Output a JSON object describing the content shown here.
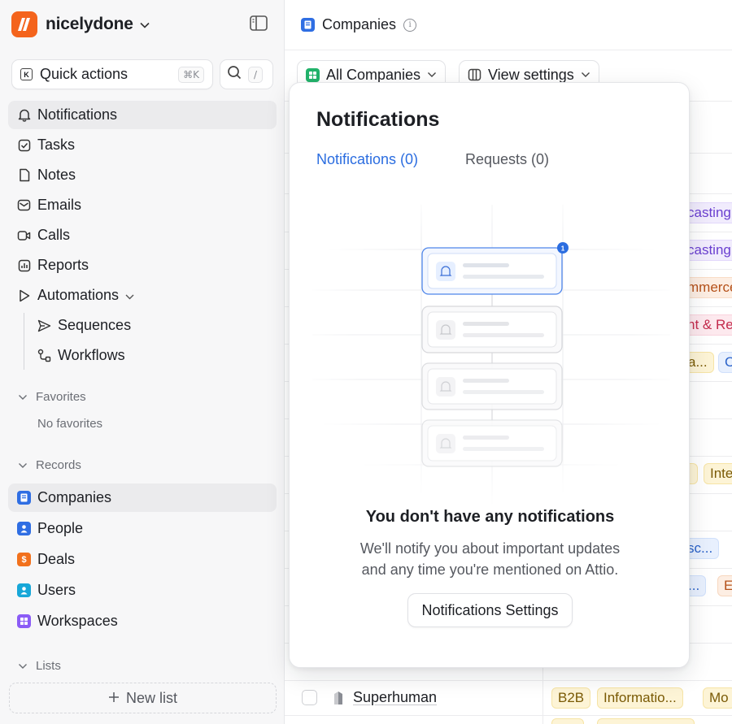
{
  "workspace": {
    "name": "nicelydone"
  },
  "quick_actions": {
    "label": "Quick actions",
    "shortcut": "⌘K"
  },
  "search": {
    "shortcut": "/"
  },
  "nav": {
    "notifications": "Notifications",
    "tasks": "Tasks",
    "notes": "Notes",
    "emails": "Emails",
    "calls": "Calls",
    "reports": "Reports",
    "automations": "Automations",
    "sequences": "Sequences",
    "workflows": "Workflows"
  },
  "favorites": {
    "heading": "Favorites",
    "empty": "No favorites"
  },
  "records": {
    "heading": "Records",
    "items": [
      "Companies",
      "People",
      "Deals",
      "Users",
      "Workspaces"
    ]
  },
  "lists": {
    "heading": "Lists",
    "new_list": "New list"
  },
  "page": {
    "title": "Companies"
  },
  "views": {
    "current": "All Companies",
    "settings": "View settings"
  },
  "table": {
    "visible_tags": [
      "casting",
      "casting",
      "mmerce",
      "nt & Re",
      "a...",
      "C",
      "Inte",
      "sc...",
      "...",
      "E"
    ],
    "last_row": {
      "name": "Superhuman",
      "tags": [
        "B2B",
        "Informatio...",
        "Mo"
      ]
    }
  },
  "notifications_panel": {
    "title": "Notifications",
    "tabs": [
      "Notifications (0)",
      "Requests (0)"
    ],
    "badge_count": "1",
    "empty_title": "You don't have any notifications",
    "empty_desc_line1": "We'll notify you about important updates",
    "empty_desc_line2": "and any time you're mentioned on Attio.",
    "settings_button": "Notifications Settings"
  },
  "colors": {
    "brand": "#f4641c",
    "accent_blue": "#2b6de0",
    "active_nav_bg": "#ebebed"
  }
}
